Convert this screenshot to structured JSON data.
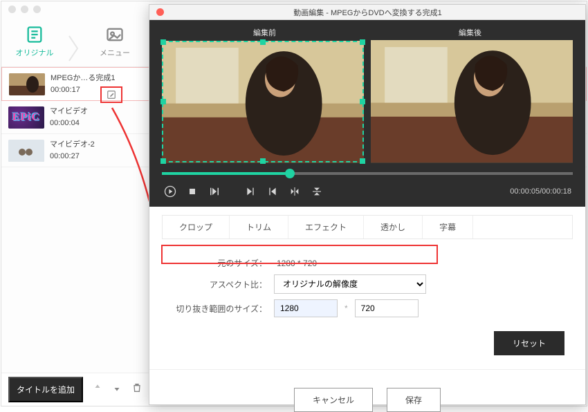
{
  "sidebar": {
    "tabs": {
      "original": "オリジナル",
      "menu": "メニュー"
    },
    "clips": [
      {
        "title": "MPEGか…る完成1",
        "duration": "00:00:17"
      },
      {
        "title": "マイビデオ",
        "duration": "00:00:04",
        "epic_text": "EPiC"
      },
      {
        "title": "マイビデオ-2",
        "duration": "00:00:27"
      }
    ],
    "add_title_btn": "タイトルを追加"
  },
  "editor": {
    "window_title": "動画編集 - MPEGからDVDへ変換する完成1",
    "before_label": "編集前",
    "after_label": "編集後",
    "timecode": "00:00:05/00:00:18",
    "tabs": {
      "crop": "クロップ",
      "trim": "トリム",
      "effect": "エフェクト",
      "watermark": "透かし",
      "subtitle": "字幕"
    },
    "form": {
      "orig_label": "元のサイズ：",
      "orig_value": "1280 * 720",
      "aspect_label": "アスペクト比：",
      "aspect_value": "オリジナルの解像度",
      "crop_label": "切り抜き範囲のサイズ：",
      "crop_w": "1280",
      "crop_h": "720",
      "reset": "リセット",
      "cancel": "キャンセル",
      "save": "保存"
    }
  }
}
